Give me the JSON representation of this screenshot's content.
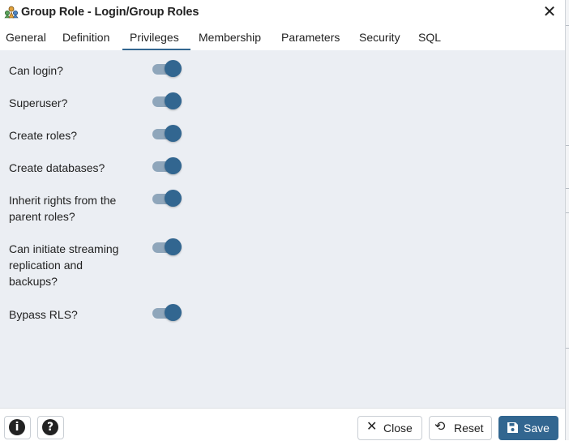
{
  "window": {
    "title": "Group Role - Login/Group Roles",
    "close_glyph": "✕"
  },
  "tabs": [
    {
      "label": "General"
    },
    {
      "label": "Definition"
    },
    {
      "label": "Privileges",
      "active": true
    },
    {
      "label": "Membership"
    },
    {
      "label": "Parameters"
    },
    {
      "label": "Security"
    },
    {
      "label": "SQL"
    }
  ],
  "privileges": [
    {
      "label": "Can login?",
      "on": true
    },
    {
      "label": "Superuser?",
      "on": true
    },
    {
      "label": "Create roles?",
      "on": true
    },
    {
      "label": "Create databases?",
      "on": true
    },
    {
      "label": "Inherit rights from the parent roles?",
      "on": true
    },
    {
      "label": "Can initiate streaming replication and backups?",
      "on": true
    },
    {
      "label": "Bypass RLS?",
      "on": true
    }
  ],
  "footer": {
    "info_glyph": "i",
    "help_glyph": "?",
    "close_label": "Close",
    "close_icon": "✕",
    "reset_label": "Reset",
    "reset_icon": "⟲",
    "save_label": "Save",
    "save_icon": "floppy-disk-icon"
  },
  "colors": {
    "accent": "#326690",
    "toggle_track": "#8fa6bb",
    "content_bg": "#ebeef3"
  }
}
